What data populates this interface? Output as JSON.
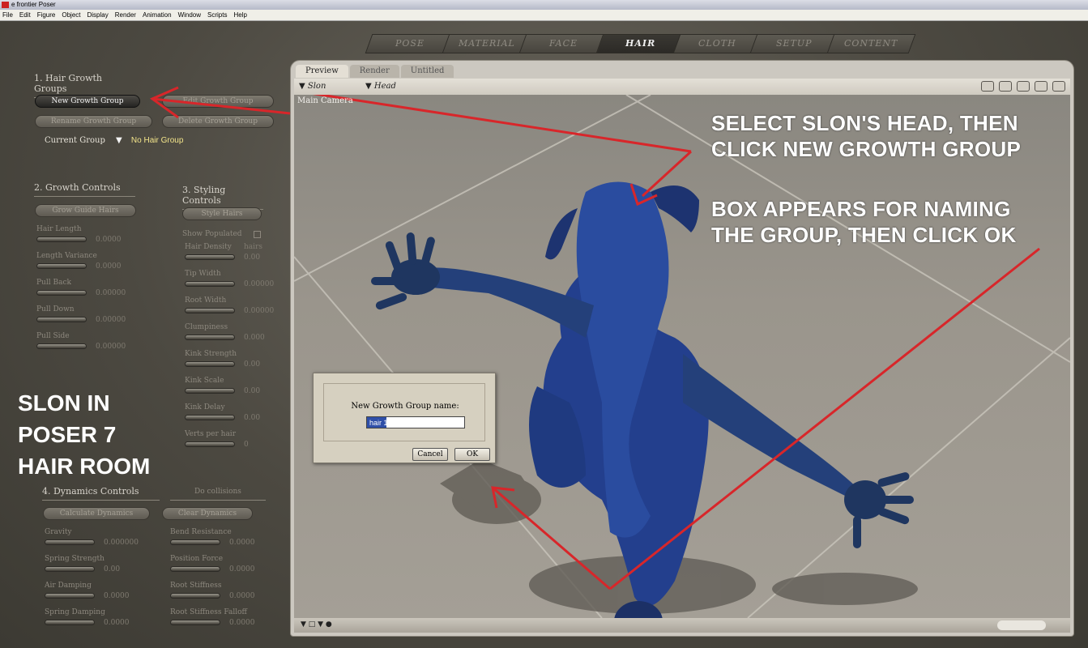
{
  "window": {
    "title": "e frontier Poser"
  },
  "menu": [
    "File",
    "Edit",
    "Figure",
    "Object",
    "Display",
    "Render",
    "Animation",
    "Window",
    "Scripts",
    "Help"
  ],
  "rooms": [
    "POSE",
    "MATERIAL",
    "FACE",
    "HAIR",
    "CLOTH",
    "SETUP",
    "CONTENT"
  ],
  "active_room": "HAIR",
  "hair_panel": {
    "section1_title": "1. Hair Growth Groups",
    "new_group_button": "New Growth Group",
    "edit_group_button": "Edit Growth Group",
    "rename_group_button": "Rename Growth Group",
    "delete_group_button": "Delete Growth Group",
    "current_group_label": "Current Group",
    "current_group_value": "No Hair Group",
    "section2_title": "2. Growth Controls",
    "grow_guide_button": "Grow Guide Hairs",
    "growth_controls": [
      {
        "label": "Hair Length",
        "value": "0.0000"
      },
      {
        "label": "Length Variance",
        "value": "0.0000"
      },
      {
        "label": "Pull Back",
        "value": "0.00000"
      },
      {
        "label": "Pull Down",
        "value": "0.00000"
      },
      {
        "label": "Pull Side",
        "value": "0.00000"
      }
    ],
    "section3_title": "3. Styling Controls",
    "style_hairs_button": "Style Hairs",
    "show_populated_label": "Show Populated",
    "styling_controls": [
      {
        "label": "Hair Density",
        "value": "0.00"
      },
      {
        "label": "Tip Width",
        "value": "0.00000"
      },
      {
        "label": "Root Width",
        "value": "0.00000"
      },
      {
        "label": "Clumpiness",
        "value": "0.000"
      },
      {
        "label": "Kink Strength",
        "value": "0.00"
      },
      {
        "label": "Kink Scale",
        "value": "0.00"
      },
      {
        "label": "Kink Delay",
        "value": "0.00"
      },
      {
        "label": "Verts per hair",
        "value": "0"
      }
    ],
    "hair_density_unit": "hairs",
    "section4_title": "4. Dynamics Controls",
    "do_collisions_label": "Do collisions",
    "calculate_dynamics_button": "Calculate Dynamics",
    "clear_dynamics_button": "Clear Dynamics",
    "dynamics_left": [
      {
        "label": "Gravity",
        "value": "0.000000"
      },
      {
        "label": "Spring Strength",
        "value": "0.00"
      },
      {
        "label": "Air Damping",
        "value": "0.0000"
      },
      {
        "label": "Spring Damping",
        "value": "0.0000"
      }
    ],
    "dynamics_right": [
      {
        "label": "Bend Resistance",
        "value": "0.0000"
      },
      {
        "label": "Position Force",
        "value": "0.0000"
      },
      {
        "label": "Root Stiffness",
        "value": "0.0000"
      },
      {
        "label": "Root Stiffness Falloff",
        "value": "0.0000"
      }
    ]
  },
  "viewport": {
    "tabs": [
      "Preview",
      "Render",
      "Untitled"
    ],
    "active_tab": "Preview",
    "figure_select": "Slon",
    "actor_select": "Head",
    "camera_label": "Main Camera"
  },
  "dialog": {
    "prompt": "New Growth Group name:",
    "input_value": "hair 1",
    "cancel_label": "Cancel",
    "ok_label": "OK"
  },
  "annotations": {
    "step1": [
      "SELECT SLON'S HEAD, THEN",
      "CLICK NEW GROWTH GROUP"
    ],
    "step2": [
      "BOX APPEARS FOR NAMING",
      "THE GROUP, THEN CLICK OK"
    ],
    "caption": [
      "SLON IN",
      "POSER 7",
      "HAIR ROOM"
    ],
    "arrow_color": "#d8262a"
  }
}
